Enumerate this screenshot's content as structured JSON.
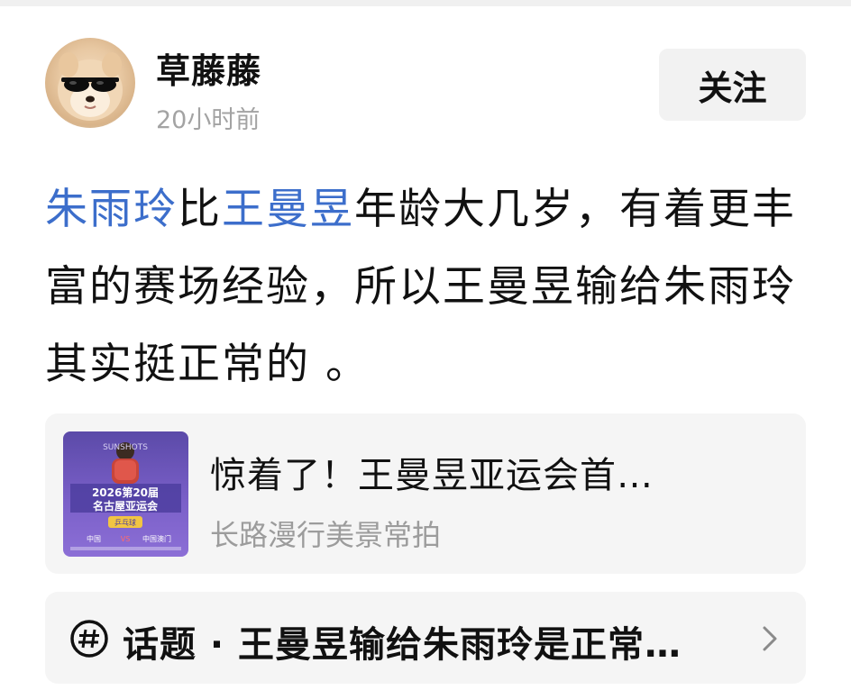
{
  "author": {
    "name": "草藤藤",
    "time": "20小时前",
    "avatar_icon": "dog-with-sunglasses-avatar"
  },
  "follow_button": {
    "label": "关注"
  },
  "post": {
    "mention_1": "朱雨玲",
    "text_1": "比",
    "mention_2": "王曼昱",
    "text_2": "年龄大几岁，有着更丰富的赛场经验，所以王曼昱输给朱雨玲其实挺正常的 。",
    "mention_color": "#3c6ecb"
  },
  "link_card": {
    "title": "惊着了！王曼昱亚运会首…",
    "source": "长路漫行美景常拍",
    "thumbnail": {
      "top_text": "SUNSHOTS",
      "headline": "2026第20届",
      "subheadline": "名古屋亚运会",
      "tag": "乒乓球",
      "left_team": "中国",
      "vs": "VS",
      "right_team": "中国澳门"
    }
  },
  "topic": {
    "label": "话题 · 王曼昱输给朱雨玲是正常…",
    "icon": "hashtag-icon",
    "chevron": "chevron-right-icon"
  },
  "colors": {
    "text": "#111111",
    "muted": "#a3a3a3",
    "card_bg": "#f5f5f5",
    "button_bg": "#f2f2f2"
  }
}
